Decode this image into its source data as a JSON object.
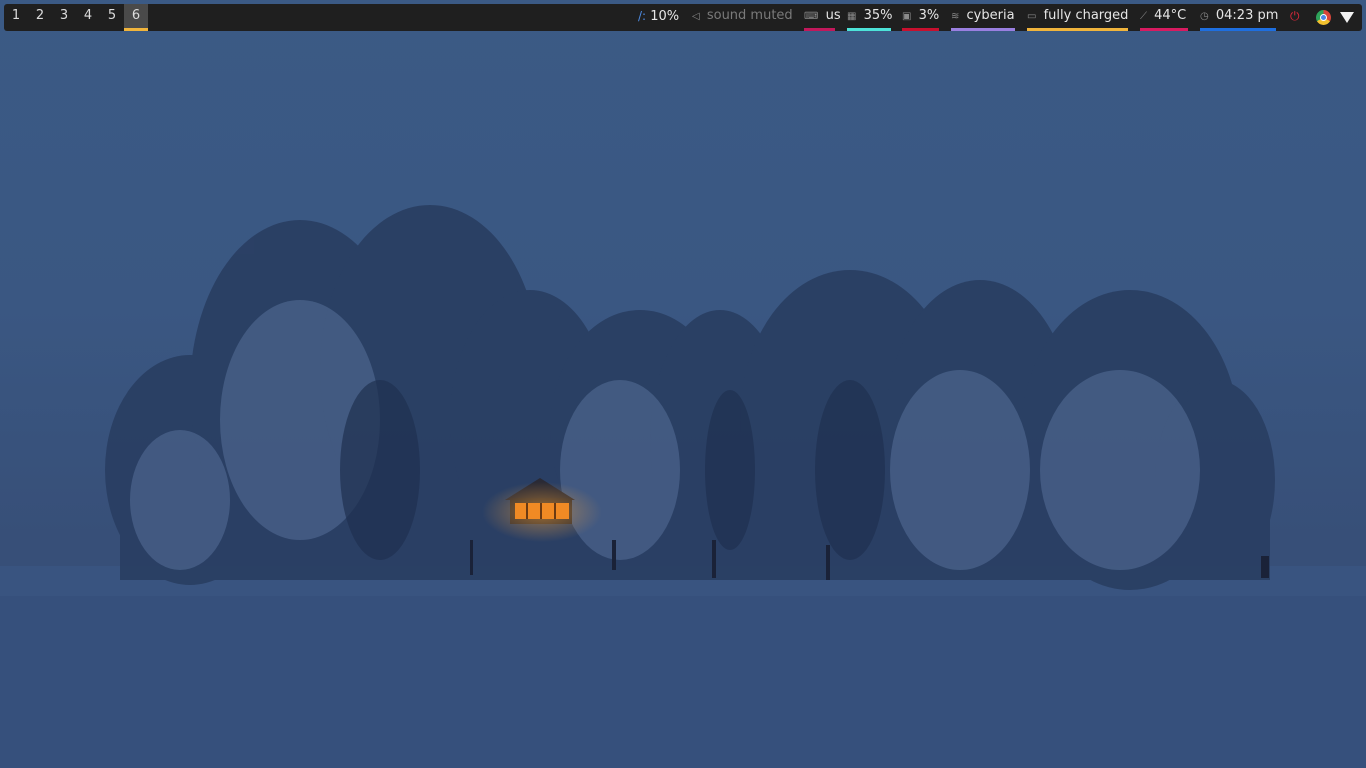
{
  "workspaces": {
    "items": [
      "1",
      "2",
      "3",
      "4",
      "5",
      "6"
    ],
    "active": "6",
    "active_color": "#f0b43c"
  },
  "status": {
    "filesystem": {
      "icon": "/:",
      "value": "10%"
    },
    "sound": {
      "icon": "speaker-icon",
      "text": "sound muted"
    },
    "keyboard": {
      "icon": "keyboard-icon",
      "value": "us",
      "color": "#c2185b"
    },
    "memory": {
      "icon": "memory-icon",
      "value": "35%",
      "color": "#4de3d9"
    },
    "cpu": {
      "icon": "cpu-icon",
      "value": "3%",
      "color": "#c8102e"
    },
    "wifi": {
      "icon": "wifi-icon",
      "value": "cyberia",
      "color": "#9a7fe0"
    },
    "battery": {
      "icon": "battery-icon",
      "value": "fully charged",
      "color": "#f0b43c"
    },
    "temperature": {
      "icon": "thermometer-icon",
      "value": "44°C",
      "color": "#d81b60"
    },
    "clock": {
      "icon": "clock-icon",
      "value": "04:23 pm",
      "color": "#1e6fe0"
    },
    "power": {
      "icon": "power-icon",
      "color": "#d8283a"
    }
  },
  "tray": [
    {
      "icon": "chrome-icon"
    },
    {
      "icon": "network-tray-icon"
    }
  ],
  "colors": {
    "bar_background": "#1f1f1f",
    "wallpaper_sky": "#3b5a85",
    "wallpaper_snow": "#35507c",
    "cabin_light": "#f08a24"
  }
}
